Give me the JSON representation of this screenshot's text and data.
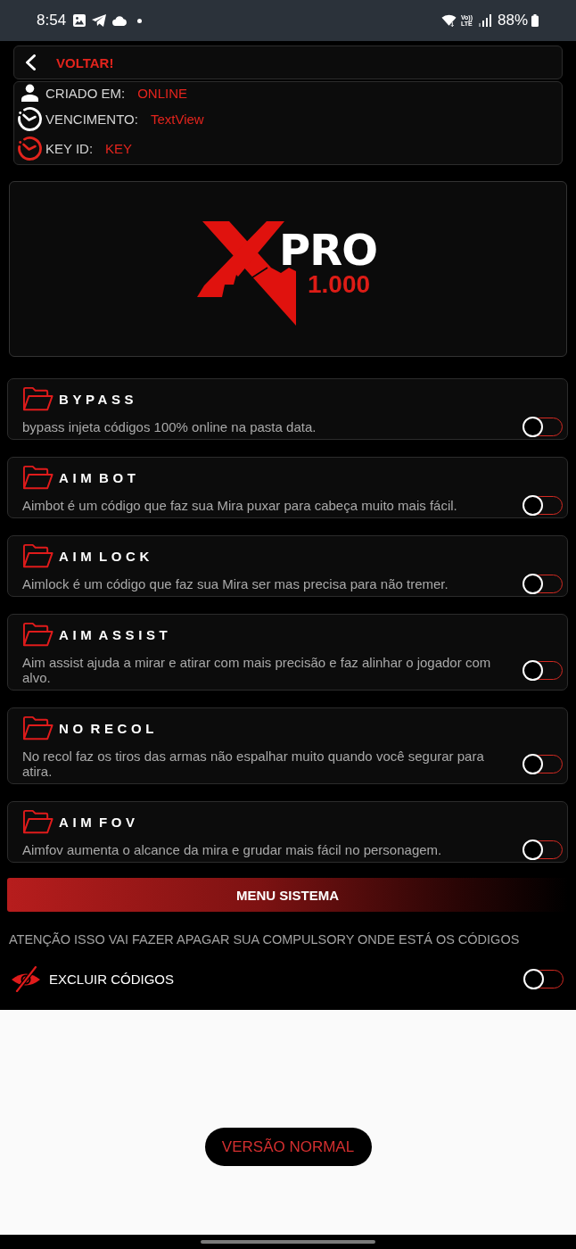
{
  "status_bar": {
    "time": "8:54",
    "network": [
      "Vo))",
      "LTE"
    ],
    "battery": "88%"
  },
  "back_button": {
    "label": "VOLTAR!"
  },
  "account_info": [
    {
      "kind": "person",
      "label": "CRIADO EM:",
      "value": "ONLINE"
    },
    {
      "kind": "timer",
      "label": "VENCIMENTO:",
      "value": "TextView"
    },
    {
      "kind": "timer-alert",
      "label": "KEY ID:",
      "value": "KEY"
    }
  ],
  "logo": {
    "word": "PRO",
    "version": "1.000"
  },
  "features": [
    {
      "title": "BYPASS",
      "description": "bypass injeta códigos 100% online na pasta data.",
      "on": false
    },
    {
      "title": "AIM BOT",
      "description": "Aimbot é um código que faz sua Mira puxar para cabeça muito mais fácil.",
      "on": false
    },
    {
      "title": "AIM LOCK",
      "description": "Aimlock é um código que faz sua Mira ser mas precisa para não tremer.",
      "on": false
    },
    {
      "title": "AIM ASSIST",
      "description": "Aim assist ajuda a mirar e atirar com mais precisão e faz alinhar o jogador com alvo.",
      "on": false
    },
    {
      "title": "NO RECOL",
      "description": "No recol faz os tiros das armas não espalhar muito quando você segurar para atira.",
      "on": false
    },
    {
      "title": "AIM FOV",
      "description": "Aimfov aumenta o alcance da mira e grudar mais fácil no personagem.",
      "on": false
    }
  ],
  "system_menu": {
    "title": "MENU SISTEMA",
    "warning": "ATENÇÃO ISSO VAI FAZER APAGAR SUA COMPULSORY ONDE ESTÁ OS CÓDIGOS",
    "option": {
      "label": "EXCLUIR CÓDIGOS",
      "on": false
    }
  },
  "normal_version_button": {
    "label": "VERSÃO NORMAL"
  }
}
